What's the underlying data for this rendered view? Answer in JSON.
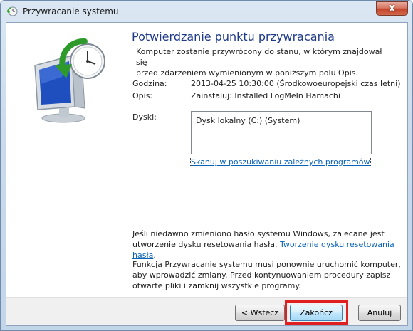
{
  "window": {
    "title": "Przywracanie systemu",
    "close_label": "X"
  },
  "main": {
    "heading": "Potwierdzanie punktu przywracania",
    "intro": "Komputer zostanie przywrócony do stanu, w którym znajdował się\nprzed zdarzeniem wymienionym w poniższym polu Opis.",
    "fields": {
      "time_label": "Godzina:",
      "time_value": "2013-04-25 10:30:00 (Środkowoeuropejski czas letni)",
      "desc_label": "Opis:",
      "desc_value": "Zainstaluj: Installed LogMeIn Hamachi",
      "disks_label": "Dyski:"
    },
    "disks": [
      "Dysk lokalny (C:) (System)"
    ],
    "scan_link": "Skanuj w poszukiwaniu zależnych programów",
    "password_note_prefix": "Jeśli niedawno zmieniono hasło systemu Windows, zalecane jest utworzenie dysku resetowania hasła. ",
    "password_link": "Tworzenie dysku resetowania hasła",
    "password_note_suffix": ".",
    "restart_note": "Funkcja Przywracanie systemu musi ponownie uruchomić komputer, aby wprowadzić zmiany. Przed kontynuowaniem procedury zapisz otwarte pliki i zamknij wszystkie programy."
  },
  "buttons": {
    "back": "< Wstecz",
    "finish": "Zakończ",
    "cancel": "Anuluj"
  },
  "icons": {
    "title": "system-restore-icon",
    "hero": "system-restore-large-icon"
  },
  "colors": {
    "heading": "#1e3a87",
    "link": "#0b63b8",
    "highlight": "#e02020"
  }
}
